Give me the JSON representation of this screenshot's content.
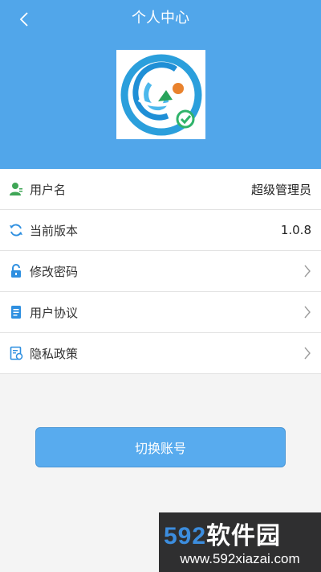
{
  "header": {
    "title": "个人中心",
    "back_icon": "chevron-left-icon",
    "background": "#51a6ea"
  },
  "logo": {
    "icon": "app-logo",
    "letters": "GI"
  },
  "items": [
    {
      "icon": "user-icon",
      "label": "用户名",
      "value": "超级管理员"
    },
    {
      "icon": "refresh-icon",
      "label": "当前版本",
      "value": "1.0.8"
    },
    {
      "icon": "unlock-icon",
      "label": "修改密码",
      "value": ""
    },
    {
      "icon": "document-icon",
      "label": "用户协议",
      "value": ""
    },
    {
      "icon": "privacy-doc-icon",
      "label": "隐私政策",
      "value": ""
    }
  ],
  "switch_button": {
    "label": "切换账号",
    "color": "#58abee"
  },
  "watermark": {
    "number": "592",
    "name": "软件园",
    "url": "www.592xiazai.com"
  }
}
